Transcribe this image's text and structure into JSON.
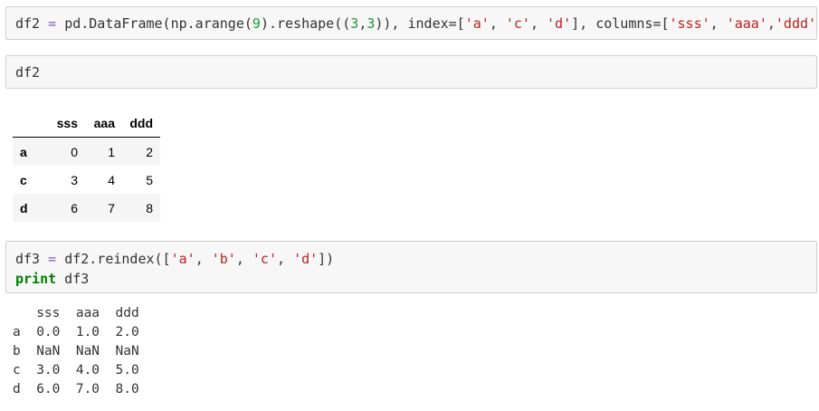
{
  "cells": {
    "cell1": {
      "tokens": [
        {
          "t": "df2",
          "c": "tok-var"
        },
        {
          "t": " = ",
          "c": "tok-op"
        },
        {
          "t": "pd.DataFrame(np.arange(",
          "c": "tok-fn"
        },
        {
          "t": "9",
          "c": "tok-num"
        },
        {
          "t": ").reshape((",
          "c": "tok-fn"
        },
        {
          "t": "3",
          "c": "tok-num"
        },
        {
          "t": ",",
          "c": "tok-fn"
        },
        {
          "t": "3",
          "c": "tok-num"
        },
        {
          "t": ")), index=[",
          "c": "tok-fn"
        },
        {
          "t": "'a'",
          "c": "tok-str"
        },
        {
          "t": ", ",
          "c": "tok-fn"
        },
        {
          "t": "'c'",
          "c": "tok-str"
        },
        {
          "t": ", ",
          "c": "tok-fn"
        },
        {
          "t": "'d'",
          "c": "tok-str"
        },
        {
          "t": "], columns=[",
          "c": "tok-fn"
        },
        {
          "t": "'sss'",
          "c": "tok-str"
        },
        {
          "t": ", ",
          "c": "tok-fn"
        },
        {
          "t": "'aaa'",
          "c": "tok-str"
        },
        {
          "t": ",",
          "c": "tok-fn"
        },
        {
          "t": "'ddd'",
          "c": "tok-str"
        },
        {
          "t": "])",
          "c": "tok-fn"
        }
      ]
    },
    "cell2": {
      "tokens": [
        {
          "t": "df2",
          "c": "tok-var"
        }
      ]
    },
    "cell3": {
      "lines": [
        [
          {
            "t": "df3",
            "c": "tok-var"
          },
          {
            "t": " = ",
            "c": "tok-op"
          },
          {
            "t": "df2.reindex([",
            "c": "tok-fn"
          },
          {
            "t": "'a'",
            "c": "tok-str"
          },
          {
            "t": ", ",
            "c": "tok-fn"
          },
          {
            "t": "'b'",
            "c": "tok-str"
          },
          {
            "t": ", ",
            "c": "tok-fn"
          },
          {
            "t": "'c'",
            "c": "tok-str"
          },
          {
            "t": ", ",
            "c": "tok-fn"
          },
          {
            "t": "'d'",
            "c": "tok-str"
          },
          {
            "t": "])",
            "c": "tok-fn"
          }
        ],
        [
          {
            "t": "print",
            "c": "tok-kw"
          },
          {
            "t": " df3",
            "c": "tok-fn"
          }
        ]
      ]
    }
  },
  "df2_output": {
    "columns": [
      "sss",
      "aaa",
      "ddd"
    ],
    "rows": [
      {
        "index": "a",
        "values": [
          "0",
          "1",
          "2"
        ]
      },
      {
        "index": "c",
        "values": [
          "3",
          "4",
          "5"
        ]
      },
      {
        "index": "d",
        "values": [
          "6",
          "7",
          "8"
        ]
      }
    ]
  },
  "df3_output": {
    "lines": [
      "   sss  aaa  ddd",
      "a  0.0  1.0  2.0",
      "b  NaN  NaN  NaN",
      "c  3.0  4.0  5.0",
      "d  6.0  7.0  8.0"
    ]
  }
}
